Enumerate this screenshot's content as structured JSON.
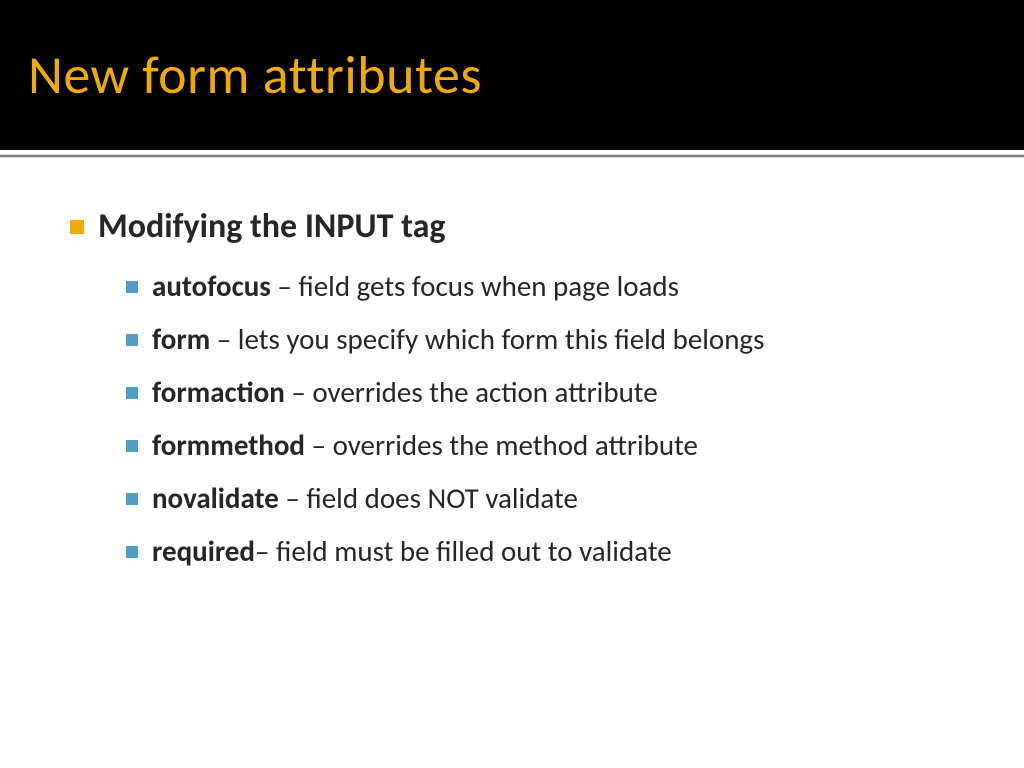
{
  "title": "New form attributes",
  "heading": "Modifying the INPUT tag",
  "items": [
    {
      "term": "autofocus",
      "sep": " – ",
      "desc": "field gets focus when page loads"
    },
    {
      "term": "form",
      "sep": " – ",
      "desc": "lets you specify which form this field belongs"
    },
    {
      "term": "formaction",
      "sep": " – ",
      "desc": "overrides the action attribute"
    },
    {
      "term": "formmethod",
      "sep": " – ",
      "desc": "overrides the method attribute"
    },
    {
      "term": "novalidate",
      "sep": " – ",
      "desc": "field does NOT validate"
    },
    {
      "term": "required",
      "sep": "– ",
      "desc": "field must be filled out to validate"
    }
  ],
  "colors": {
    "title_text": "#f0ab00",
    "title_bg": "#000000",
    "bullet_l1": "#f0ab00",
    "bullet_l2": "#4f9ec4",
    "body_text": "#262626"
  }
}
